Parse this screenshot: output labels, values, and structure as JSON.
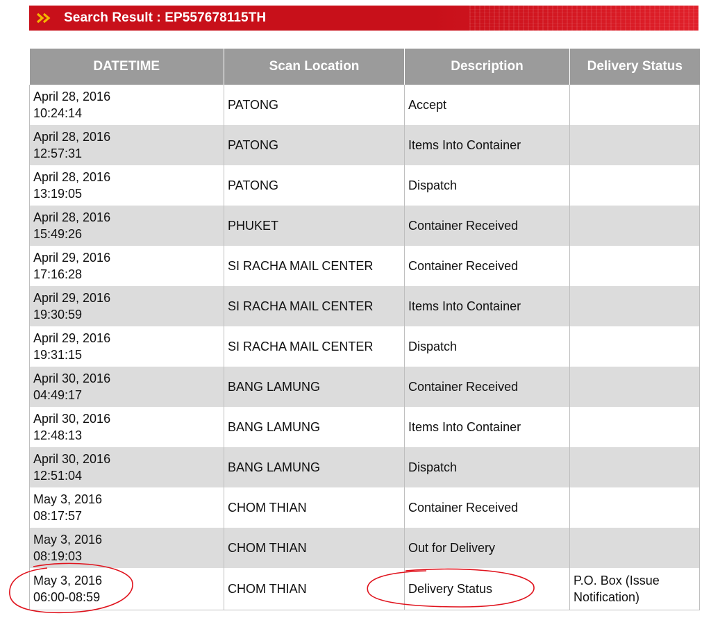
{
  "header": {
    "title": "Search Result : EP557678115TH",
    "bar_color": "#c8101a",
    "chevron_color": "#f5b400",
    "icon": "double-chevron-right-icon"
  },
  "table": {
    "columns": [
      "DATETIME",
      "Scan Location",
      "Description",
      "Delivery Status"
    ],
    "header_color": "#9b9b9b",
    "stripe_color": "#dcdcdc",
    "rows": [
      {
        "date": "April 28, 2016",
        "time": "10:24:14",
        "location": "PATONG",
        "description": "Accept",
        "status": ""
      },
      {
        "date": "April 28, 2016",
        "time": "12:57:31",
        "location": "PATONG",
        "description": "Items Into Container",
        "status": ""
      },
      {
        "date": "April 28, 2016",
        "time": "13:19:05",
        "location": "PATONG",
        "description": "Dispatch",
        "status": ""
      },
      {
        "date": "April 28, 2016",
        "time": "15:49:26",
        "location": "PHUKET",
        "description": "Container Received",
        "status": ""
      },
      {
        "date": "April 29, 2016",
        "time": "17:16:28",
        "location": "SI RACHA MAIL CENTER",
        "description": "Container Received",
        "status": ""
      },
      {
        "date": "April 29, 2016",
        "time": "19:30:59",
        "location": "SI RACHA MAIL CENTER",
        "description": "Items Into Container",
        "status": ""
      },
      {
        "date": "April 29, 2016",
        "time": "19:31:15",
        "location": "SI RACHA MAIL CENTER",
        "description": "Dispatch",
        "status": ""
      },
      {
        "date": "April 30, 2016",
        "time": "04:49:17",
        "location": "BANG LAMUNG",
        "description": "Container Received",
        "status": ""
      },
      {
        "date": "April 30, 2016",
        "time": "12:48:13",
        "location": "BANG LAMUNG",
        "description": "Items Into Container",
        "status": ""
      },
      {
        "date": "April 30, 2016",
        "time": "12:51:04",
        "location": "BANG LAMUNG",
        "description": "Dispatch",
        "status": ""
      },
      {
        "date": "May 3, 2016",
        "time": "08:17:57",
        "location": "CHOM THIAN",
        "description": "Container Received",
        "status": ""
      },
      {
        "date": "May 3, 2016",
        "time": "08:19:03",
        "location": "CHOM THIAN",
        "description": "Out for Delivery",
        "status": ""
      },
      {
        "date": "May 3, 2016",
        "time": "06:00-08:59",
        "location": "CHOM THIAN",
        "description": "Delivery Status",
        "status": "P.O. Box (Issue Notification)"
      }
    ]
  },
  "annotations": {
    "ink_color": "#e0141e"
  }
}
